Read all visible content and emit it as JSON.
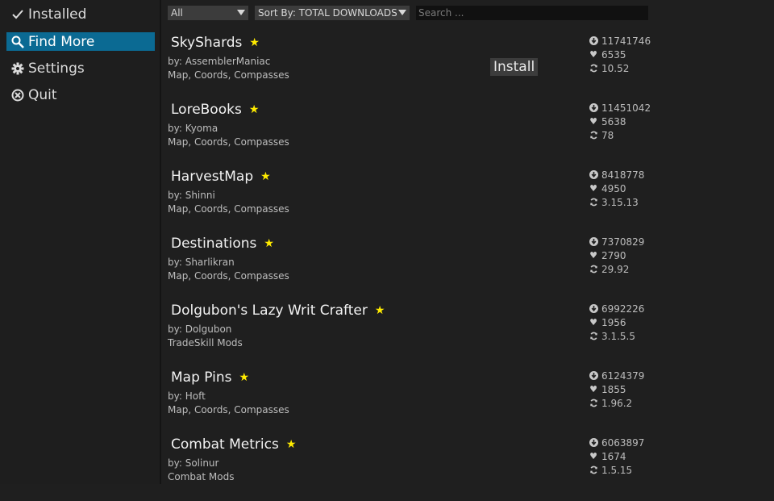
{
  "sidebar": {
    "items": [
      {
        "label": "Installed",
        "icon": "check-icon"
      },
      {
        "label": "Find More",
        "icon": "search-icon"
      },
      {
        "label": "Settings",
        "icon": "gear-icon"
      },
      {
        "label": "Quit",
        "icon": "close-circle-icon"
      }
    ],
    "active": "Find More",
    "accent": "#0b6a93"
  },
  "toolbar": {
    "filter_value": "All",
    "sort_value": "Sort By: TOTAL DOWNLOADS",
    "search_placeholder": "Search ..."
  },
  "addons": [
    {
      "title": "SkyShards",
      "author": "by: AssemblerManiac",
      "category": "Map, Coords, Compasses",
      "downloads": "11741746",
      "favorites": "6535",
      "version": "10.52"
    },
    {
      "title": "LoreBooks",
      "author": "by: Kyoma",
      "category": "Map, Coords, Compasses",
      "downloads": "11451042",
      "favorites": "5638",
      "version": "78"
    },
    {
      "title": "HarvestMap",
      "author": "by: Shinni",
      "category": "Map, Coords, Compasses",
      "downloads": "8418778",
      "favorites": "4950",
      "version": "3.15.13"
    },
    {
      "title": "Destinations",
      "author": "by: Sharlikran",
      "category": "Map, Coords, Compasses",
      "downloads": "7370829",
      "favorites": "2790",
      "version": "29.92"
    },
    {
      "title": "Dolgubon's Lazy Writ Crafter",
      "author": "by: Dolgubon",
      "category": "TradeSkill Mods",
      "downloads": "6992226",
      "favorites": "1956",
      "version": "3.1.5.5"
    },
    {
      "title": "Map Pins",
      "author": "by: Hoft",
      "category": "Map, Coords, Compasses",
      "downloads": "6124379",
      "favorites": "1855",
      "version": "1.96.2"
    },
    {
      "title": "Combat Metrics",
      "author": "by: Solinur",
      "category": "Combat Mods",
      "downloads": "6063897",
      "favorites": "1674",
      "version": "1.5.15"
    }
  ],
  "install_label": "Install",
  "star_color": "#ffeb00"
}
